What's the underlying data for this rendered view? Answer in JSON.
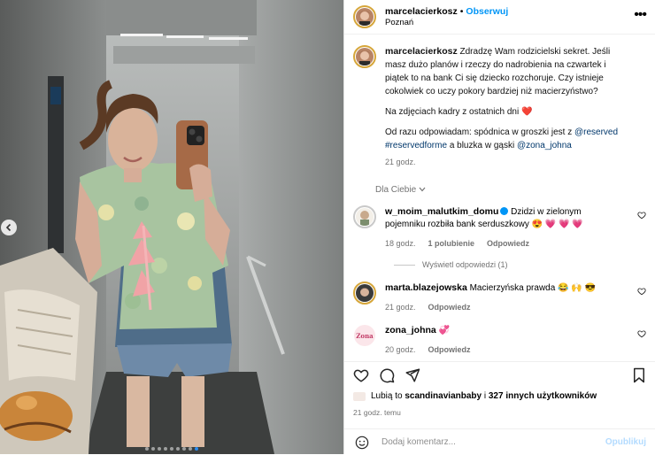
{
  "post": {
    "author": "marcelacierkosz",
    "follow_label": "Obserwuj",
    "separator": "•",
    "location": "Poznań",
    "more_label": "•••"
  },
  "caption": {
    "author": "marcelacierkosz",
    "paragraph1": "Zdradzę Wam rodzicielski sekret. Jeśli masz dużo planów i rzeczy do nadrobienia na czwartek i piątek to na bank Ci się dziecko rozchoruje. Czy istnieje cokolwiek co uczy pokory bardziej niż macierzyństwo?",
    "paragraph2": "Na zdjęciach kadry z ostatnich dni",
    "paragraph2_emoji": "❤️",
    "paragraph3_prefix": "Od razu odpowiadam: spódnica w groszki jest z",
    "tag1": "@reserved",
    "tag2": "#reservedforme",
    "paragraph3_middle": "a bluzka w gąski",
    "tag3": "@zona_johna",
    "time": "21 godz."
  },
  "sort": {
    "label": "Dla Ciebie",
    "icon": "chevron-down-icon"
  },
  "comments": [
    {
      "author": "w_moim_malutkim_domu",
      "verified": true,
      "text": "Dzidzi w zielonym pojemniku rozbiła bank serduszkowy",
      "emoji": "😍 💗 💗 💗",
      "time": "18 godz.",
      "likes": "1 polubienie",
      "reply": "Odpowiedz",
      "view_replies": "Wyświetl odpowiedzi (1)"
    },
    {
      "author": "marta.blazejowska",
      "text": "Macierzyńska prawda",
      "emoji": "😂 🙌 😎",
      "time": "21 godz.",
      "reply": "Odpowiedz"
    },
    {
      "author": "zona_johna",
      "text": "",
      "emoji": "💞",
      "avatar_text": "Zona",
      "time": "20 godz.",
      "reply": "Odpowiedz"
    }
  ],
  "likes": {
    "prefix": "Lubią to",
    "user": "scandinavianbaby",
    "middle": "i",
    "others": "327 innych użytkowników"
  },
  "posted_ago": "21 godz. temu",
  "composer": {
    "placeholder": "Dodaj komentarz...",
    "publish": "Opublikuj"
  },
  "carousel": {
    "total": 9,
    "active": 9
  },
  "colors": {
    "link": "#00376b",
    "accent": "#0095f6",
    "muted": "#737373",
    "heart": "#ed4956"
  }
}
